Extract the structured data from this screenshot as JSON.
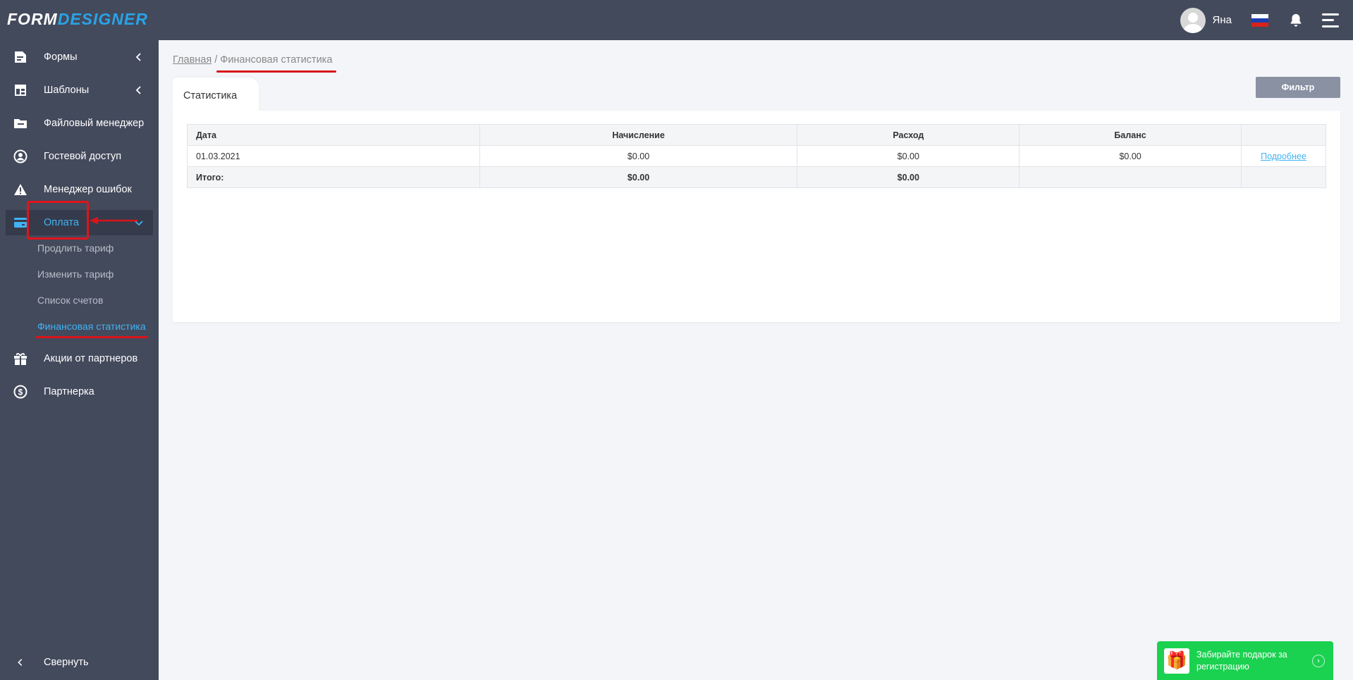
{
  "app": {
    "logo_part1": "FORM",
    "logo_part2": "DESIGNER",
    "brand_color": "#2aa3e6"
  },
  "header": {
    "username": "Яна",
    "flag_colors": [
      "#ffffff",
      "#1c3fae",
      "#d8231b"
    ],
    "icons": [
      "avatar-icon",
      "russian-flag-icon",
      "bell-icon",
      "menu-icon"
    ]
  },
  "sidebar": {
    "items": [
      {
        "label": "Формы",
        "icon": "form-icon",
        "chevron": "left"
      },
      {
        "label": "Шаблоны",
        "icon": "template-icon",
        "chevron": "left"
      },
      {
        "label": "Файловый менеджер",
        "icon": "folder-icon"
      },
      {
        "label": "Гостевой доступ",
        "icon": "user-circle-icon"
      },
      {
        "label": "Менеджер ошибок",
        "icon": "warning-icon"
      },
      {
        "label": "Оплата",
        "icon": "credit-card-icon",
        "chevron": "down",
        "active": true
      },
      {
        "label": "Акции от партнеров",
        "icon": "gift-icon"
      },
      {
        "label": "Партнерка",
        "icon": "dollar-icon"
      }
    ],
    "subitems": [
      {
        "label": "Продлить тариф"
      },
      {
        "label": "Изменить тариф"
      },
      {
        "label": "Список счетов"
      },
      {
        "label": "Финансовая статистика",
        "active": true
      }
    ],
    "collapse_label": "Свернуть",
    "active_color": "#3fb3f4"
  },
  "breadcrumb": {
    "home": "Главная",
    "separator": "/",
    "current": "Финансовая статистика"
  },
  "main": {
    "tab_label": "Статистика",
    "filter_button": "Фильтр",
    "table": {
      "headers": [
        "Дата",
        "Начисление",
        "Расход",
        "Баланс",
        ""
      ],
      "rows": [
        [
          "01.03.2021",
          "$0.00",
          "$0.00",
          "$0.00",
          "Подробнее"
        ]
      ],
      "total": [
        "Итого:",
        "$0.00",
        "$0.00",
        "",
        ""
      ]
    }
  },
  "promo": {
    "text": "Забирайте подарок за регистрацию",
    "color": "#1bd150"
  },
  "annotation_color": "#e0141b"
}
